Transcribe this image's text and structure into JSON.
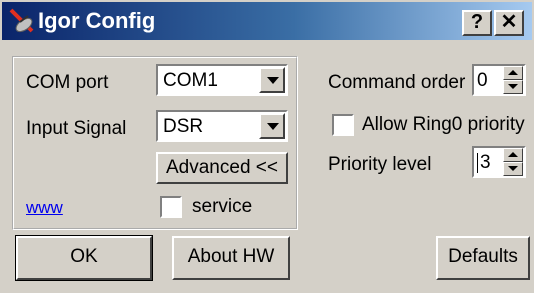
{
  "window": {
    "title": "Igor Config",
    "help_button": "?",
    "close_button": "✕"
  },
  "com_port": {
    "label": "COM port",
    "value": "COM1"
  },
  "input_signal": {
    "label": "Input Signal",
    "value": "DSR"
  },
  "advanced_button": "Advanced <<",
  "www_link": "www",
  "service": {
    "label": "service",
    "checked": false
  },
  "command_order": {
    "label": "Command order",
    "value": "0"
  },
  "allow_ring0": {
    "label": "Allow Ring0 priority",
    "checked": false
  },
  "priority_level": {
    "label": "Priority level",
    "value": "3"
  },
  "buttons": {
    "ok": "OK",
    "about": "About HW",
    "defaults": "Defaults"
  },
  "icons": {
    "app": "satellite-dish-icon"
  },
  "colors": {
    "title_start": "#0a246a",
    "title_end": "#a6caf0",
    "face": "#d4d0c8",
    "link": "#0000ee"
  }
}
